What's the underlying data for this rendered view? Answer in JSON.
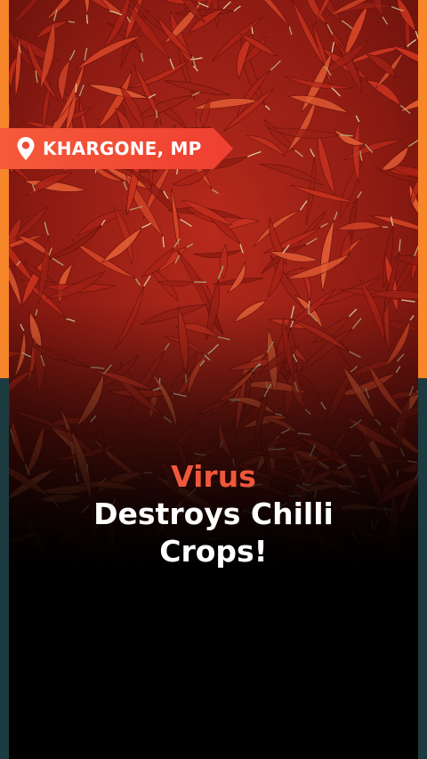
{
  "colors": {
    "frame_orange": "#f7852a",
    "frame_teal": "#1c3b40",
    "tag_red": "#f04b36",
    "headline_accent": "#f0573b",
    "headline_text": "#ffffff"
  },
  "location": {
    "icon": "map-pin-icon",
    "label": "KHARGONE, MP"
  },
  "headline": {
    "accent": "Virus",
    "line1": "Destroys Chilli",
    "line2": "Crops!"
  },
  "photo": {
    "subject": "dried-red-chillies-photo"
  }
}
